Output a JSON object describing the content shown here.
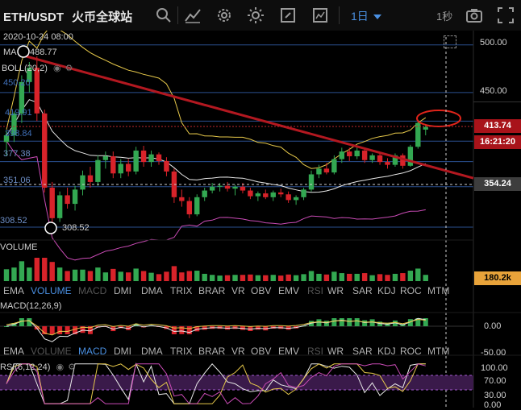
{
  "header": {
    "symbol": "ETH/USDT",
    "exchange": "火币全球站",
    "interval": "1日",
    "speed": "1秒"
  },
  "icons": [
    "search-icon",
    "indicator-icon",
    "settings-icon",
    "theme-icon",
    "fullscreen-icon",
    "layout-icon",
    "camera-icon",
    "expand-icon"
  ],
  "main": {
    "date_label": "2020-10-24 08:00",
    "ma_label": "MA",
    "ma_value": "488.77",
    "boll_label": "BOLL(20,2)",
    "price_ticks": [
      "500.00",
      "450.00"
    ],
    "current_price": "413.74",
    "countdown": "16:21:20",
    "crosshair_price": "354.24",
    "left_levels": [
      "450.20",
      "419.91",
      "398.84",
      "377.38",
      "351.06",
      "308.52"
    ],
    "low_marker": "308.52"
  },
  "volume": {
    "label": "VOLUME",
    "value": "180.2k"
  },
  "tabs": [
    "EMA",
    "VOLUME",
    "MACD",
    "DMI",
    "DMA",
    "TRIX",
    "BRAR",
    "VR",
    "OBV",
    "EMV",
    "RSI",
    "WR",
    "SAR",
    "KDJ",
    "ROC",
    "MTM"
  ],
  "macd": {
    "label": "MACD(12,26,9)",
    "ticks": [
      "0.00",
      "-50.00"
    ]
  },
  "rsi": {
    "label": "RSI(6,12,24)",
    "ticks": [
      "100.00",
      "70.00",
      "30.00",
      "0.00"
    ]
  },
  "colors": {
    "up": "#33a852",
    "down": "#d8232a",
    "accent": "#4a90e2",
    "trend": "#b31820",
    "price_badge": "#a8131a",
    "volume_badge": "#e8a33a"
  },
  "chart_data": {
    "type": "candlestick",
    "symbol": "ETH/USDT",
    "y_range": [
      295,
      515
    ],
    "candles": [
      {
        "o": 398,
        "h": 410,
        "l": 383,
        "c": 405
      },
      {
        "o": 405,
        "h": 430,
        "l": 398,
        "c": 428
      },
      {
        "o": 428,
        "h": 468,
        "l": 418,
        "c": 461
      },
      {
        "o": 461,
        "h": 482,
        "l": 450,
        "c": 476
      },
      {
        "o": 476,
        "h": 488,
        "l": 420,
        "c": 428
      },
      {
        "o": 428,
        "h": 432,
        "l": 345,
        "c": 350
      },
      {
        "o": 350,
        "h": 356,
        "l": 308,
        "c": 318
      },
      {
        "o": 318,
        "h": 346,
        "l": 314,
        "c": 342
      },
      {
        "o": 342,
        "h": 350,
        "l": 328,
        "c": 333
      },
      {
        "o": 333,
        "h": 352,
        "l": 326,
        "c": 348
      },
      {
        "o": 348,
        "h": 368,
        "l": 342,
        "c": 363
      },
      {
        "o": 363,
        "h": 372,
        "l": 350,
        "c": 356
      },
      {
        "o": 356,
        "h": 384,
        "l": 352,
        "c": 379
      },
      {
        "o": 379,
        "h": 388,
        "l": 370,
        "c": 383
      },
      {
        "o": 383,
        "h": 388,
        "l": 360,
        "c": 365
      },
      {
        "o": 365,
        "h": 380,
        "l": 360,
        "c": 375
      },
      {
        "o": 375,
        "h": 380,
        "l": 362,
        "c": 367
      },
      {
        "o": 367,
        "h": 393,
        "l": 364,
        "c": 389
      },
      {
        "o": 389,
        "h": 394,
        "l": 372,
        "c": 377
      },
      {
        "o": 377,
        "h": 389,
        "l": 372,
        "c": 385
      },
      {
        "o": 385,
        "h": 387,
        "l": 374,
        "c": 378
      },
      {
        "o": 378,
        "h": 382,
        "l": 362,
        "c": 367
      },
      {
        "o": 367,
        "h": 370,
        "l": 334,
        "c": 340
      },
      {
        "o": 340,
        "h": 348,
        "l": 330,
        "c": 336
      },
      {
        "o": 336,
        "h": 340,
        "l": 318,
        "c": 322
      },
      {
        "o": 322,
        "h": 343,
        "l": 320,
        "c": 340
      },
      {
        "o": 340,
        "h": 350,
        "l": 336,
        "c": 347
      },
      {
        "o": 347,
        "h": 355,
        "l": 344,
        "c": 351
      },
      {
        "o": 351,
        "h": 355,
        "l": 346,
        "c": 352
      },
      {
        "o": 352,
        "h": 356,
        "l": 346,
        "c": 349
      },
      {
        "o": 349,
        "h": 353,
        "l": 342,
        "c": 351
      },
      {
        "o": 351,
        "h": 355,
        "l": 344,
        "c": 347
      },
      {
        "o": 347,
        "h": 350,
        "l": 338,
        "c": 341
      },
      {
        "o": 341,
        "h": 346,
        "l": 336,
        "c": 344
      },
      {
        "o": 344,
        "h": 348,
        "l": 338,
        "c": 340
      },
      {
        "o": 340,
        "h": 347,
        "l": 336,
        "c": 345
      },
      {
        "o": 345,
        "h": 349,
        "l": 340,
        "c": 343
      },
      {
        "o": 343,
        "h": 346,
        "l": 334,
        "c": 337
      },
      {
        "o": 337,
        "h": 342,
        "l": 332,
        "c": 340
      },
      {
        "o": 340,
        "h": 350,
        "l": 337,
        "c": 348
      },
      {
        "o": 348,
        "h": 368,
        "l": 346,
        "c": 364
      },
      {
        "o": 364,
        "h": 374,
        "l": 360,
        "c": 370
      },
      {
        "o": 370,
        "h": 376,
        "l": 364,
        "c": 366
      },
      {
        "o": 366,
        "h": 384,
        "l": 364,
        "c": 380
      },
      {
        "o": 380,
        "h": 392,
        "l": 376,
        "c": 388
      },
      {
        "o": 388,
        "h": 392,
        "l": 378,
        "c": 383
      },
      {
        "o": 383,
        "h": 394,
        "l": 380,
        "c": 389
      },
      {
        "o": 389,
        "h": 392,
        "l": 376,
        "c": 379
      },
      {
        "o": 379,
        "h": 386,
        "l": 376,
        "c": 384
      },
      {
        "o": 384,
        "h": 387,
        "l": 374,
        "c": 377
      },
      {
        "o": 377,
        "h": 381,
        "l": 370,
        "c": 374
      },
      {
        "o": 374,
        "h": 386,
        "l": 372,
        "c": 384
      },
      {
        "o": 384,
        "h": 386,
        "l": 370,
        "c": 373
      },
      {
        "o": 373,
        "h": 395,
        "l": 372,
        "c": 393
      },
      {
        "o": 393,
        "h": 420,
        "l": 391,
        "c": 418
      },
      {
        "o": 411,
        "h": 416,
        "l": 405,
        "c": 413.74
      }
    ]
  }
}
